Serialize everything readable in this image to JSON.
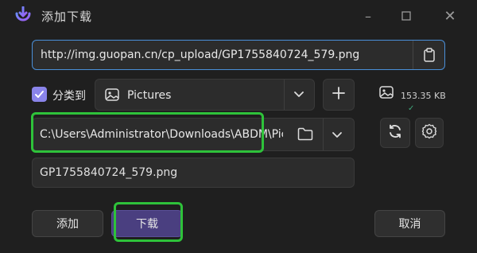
{
  "window": {
    "title": "添加下载",
    "icon": "download-app-icon",
    "controls": [
      "minimize-icon",
      "maximize-icon",
      "close-icon"
    ]
  },
  "url": {
    "value": "http://img.guopan.cn/cp_upload/GP1755840724_579.png",
    "paste_icon": "clipboard-icon"
  },
  "category": {
    "checkbox_label": "分类到",
    "checked": true,
    "selected": "Pictures",
    "add_icon": "plus-icon"
  },
  "file_info": {
    "icon": "image-icon",
    "size": "153.35 KB",
    "status_mark": "✓"
  },
  "save_path": {
    "value": "C:\\Users\\Administrator\\Downloads\\ABDM\\Pictures",
    "folder_icon": "folder-icon"
  },
  "filename": {
    "value": "GP1755840724_579.png"
  },
  "buttons": {
    "add": "添加",
    "download": "下载",
    "cancel": "取消"
  },
  "colors": {
    "background": "#1f1f1f",
    "accent": "#8a84ea",
    "highlight": "#2ec23a",
    "focus_border": "#4a8fd8"
  }
}
